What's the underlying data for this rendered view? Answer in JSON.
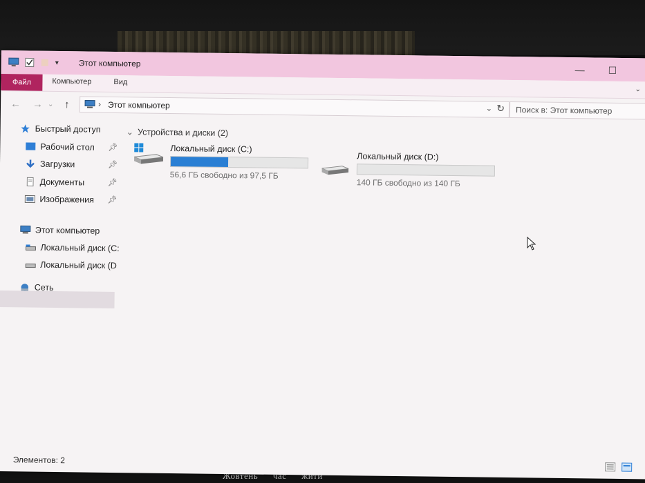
{
  "window": {
    "title": "Этот компьютер",
    "minimize": "—",
    "maximize": "☐"
  },
  "ribbon": {
    "tabs": [
      "Файл",
      "Компьютер",
      "Вид"
    ]
  },
  "address": {
    "path": "Этот компьютер",
    "separator": "›",
    "search_placeholder": "Поиск в: Этот компьютер"
  },
  "sidebar": {
    "quick_access": "Быстрый доступ",
    "items": [
      {
        "label": "Рабочий стол",
        "icon": "desktop-icon",
        "pinned": true
      },
      {
        "label": "Загрузки",
        "icon": "downloads-icon",
        "pinned": true
      },
      {
        "label": "Документы",
        "icon": "documents-icon",
        "pinned": true
      },
      {
        "label": "Изображения",
        "icon": "pictures-icon",
        "pinned": true
      }
    ],
    "this_pc": "Этот компьютер",
    "drives": [
      "Локальный диск (C:",
      "Локальный диск (D"
    ],
    "network": "Сеть"
  },
  "content": {
    "group_header": "Устройства и диски (2)",
    "drives": [
      {
        "name": "Локальный диск (C:)",
        "free_text": "56,6 ГБ свободно из 97,5 ГБ",
        "used_fraction": 0.42,
        "system": true
      },
      {
        "name": "Локальный диск (D:)",
        "free_text": "140 ГБ свободно из 140 ГБ",
        "used_fraction": 0.0,
        "system": false
      }
    ]
  },
  "status": {
    "count": "Элементов: 2"
  },
  "background": {
    "bottom_words": [
      "Жовтень",
      "час",
      "жити"
    ]
  },
  "colors": {
    "titlebar": "#f2c6df",
    "file_tab": "#b0245f",
    "drive_bar_fill": "#2a7fd4"
  }
}
